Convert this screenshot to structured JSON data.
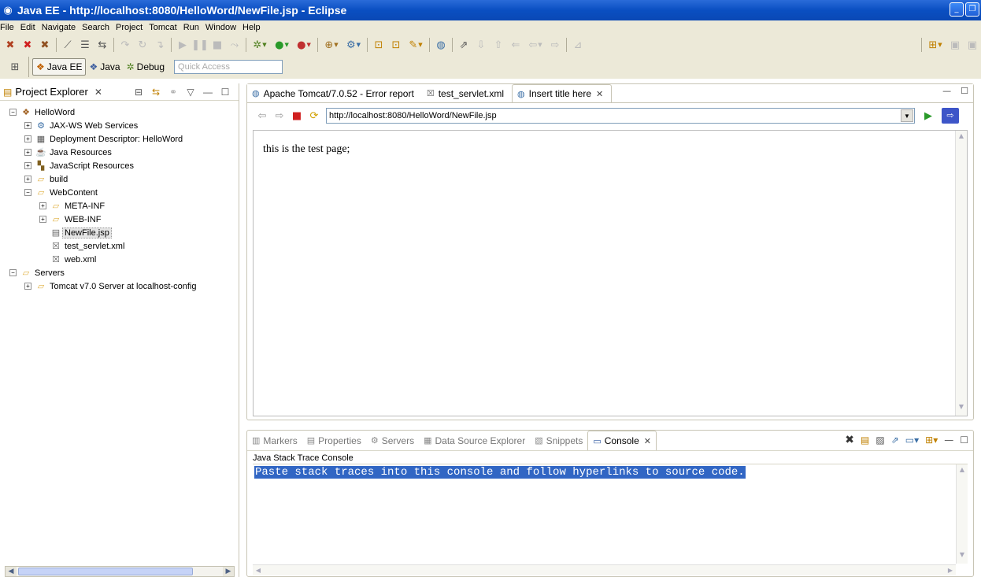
{
  "window": {
    "title": "Java EE - http://localhost:8080/HelloWord/NewFile.jsp - Eclipse"
  },
  "menu": [
    "File",
    "Edit",
    "Navigate",
    "Search",
    "Project",
    "Tomcat",
    "Run",
    "Window",
    "Help"
  ],
  "perspectives": {
    "items": [
      {
        "label": "Java EE",
        "active": true
      },
      {
        "label": "Java",
        "active": false
      },
      {
        "label": "Debug",
        "active": false
      }
    ],
    "quick_access_placeholder": "Quick Access"
  },
  "explorer": {
    "title": "Project Explorer",
    "tree": [
      {
        "label": "HelloWord",
        "level": 0,
        "toggle": "−",
        "icon": "project-icon"
      },
      {
        "label": "JAX-WS Web Services",
        "level": 1,
        "toggle": "+",
        "icon": "webservice-icon"
      },
      {
        "label": "Deployment Descriptor: HelloWord",
        "level": 1,
        "toggle": "+",
        "icon": "descriptor-icon"
      },
      {
        "label": "Java Resources",
        "level": 1,
        "toggle": "+",
        "icon": "java-resources-icon"
      },
      {
        "label": "JavaScript Resources",
        "level": 1,
        "toggle": "+",
        "icon": "javascript-icon"
      },
      {
        "label": "build",
        "level": 1,
        "toggle": "+",
        "icon": "folder-icon"
      },
      {
        "label": "WebContent",
        "level": 1,
        "toggle": "−",
        "icon": "folder-icon"
      },
      {
        "label": "META-INF",
        "level": 2,
        "toggle": "+",
        "icon": "folder-icon"
      },
      {
        "label": "WEB-INF",
        "level": 2,
        "toggle": "+",
        "icon": "folder-icon"
      },
      {
        "label": "NewFile.jsp",
        "level": 2,
        "toggle": "",
        "icon": "jsp-file-icon",
        "selected": true
      },
      {
        "label": "test_servlet.xml",
        "level": 2,
        "toggle": "",
        "icon": "xml-file-icon"
      },
      {
        "label": "web.xml",
        "level": 2,
        "toggle": "",
        "icon": "xml-file-icon"
      },
      {
        "label": "Servers",
        "level": 0,
        "toggle": "−",
        "icon": "folder-icon"
      },
      {
        "label": "Tomcat v7.0 Server at localhost-config",
        "level": 1,
        "toggle": "+",
        "icon": "folder-icon"
      }
    ]
  },
  "editor": {
    "tabs": [
      {
        "label": "Apache Tomcat/7.0.52 - Error report",
        "icon": "globe-icon",
        "active": false
      },
      {
        "label": "test_servlet.xml",
        "icon": "xml-file-icon",
        "active": false
      },
      {
        "label": "Insert title here",
        "icon": "globe-icon",
        "active": true
      }
    ],
    "url": "http://localhost:8080/HelloWord/NewFile.jsp",
    "page_text": "this is the test page;"
  },
  "console": {
    "tabs": [
      {
        "label": "Markers",
        "icon": "markers-icon",
        "active": false
      },
      {
        "label": "Properties",
        "icon": "properties-icon",
        "active": false
      },
      {
        "label": "Servers",
        "icon": "servers-icon",
        "active": false
      },
      {
        "label": "Data Source Explorer",
        "icon": "datasource-icon",
        "active": false
      },
      {
        "label": "Snippets",
        "icon": "snippets-icon",
        "active": false
      },
      {
        "label": "Console",
        "icon": "console-icon",
        "active": true
      }
    ],
    "label": "Java Stack Trace Console",
    "output": "Paste stack traces into this console and follow hyperlinks to source code."
  }
}
